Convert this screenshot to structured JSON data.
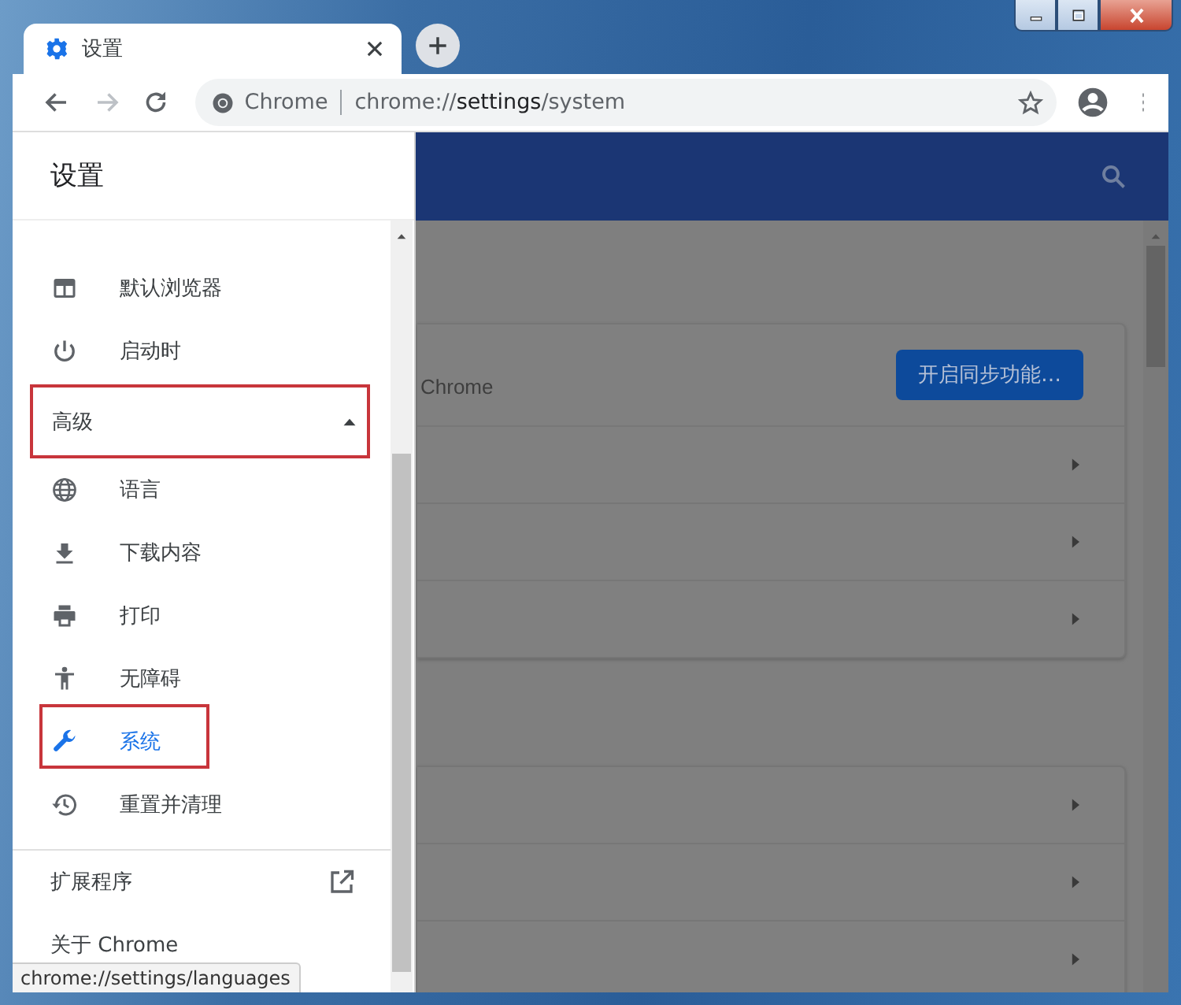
{
  "tabs": [
    {
      "title": "设置",
      "selected": true
    }
  ],
  "toolbar": {
    "site_label": "Chrome",
    "url": {
      "scheme": "chrome://",
      "host": "settings",
      "path": "/system"
    }
  },
  "drawer": {
    "title": "设置",
    "items": [
      {
        "kind": "nav",
        "label": "默认浏览器",
        "selected": false,
        "highlighted": false
      },
      {
        "kind": "nav",
        "label": "启动时",
        "selected": false,
        "highlighted": false
      },
      {
        "kind": "section",
        "label": "高级",
        "expanded": true,
        "highlighted": true
      },
      {
        "kind": "nav",
        "label": "语言",
        "selected": false,
        "highlighted": false
      },
      {
        "kind": "nav",
        "label": "下载内容",
        "selected": false,
        "highlighted": false
      },
      {
        "kind": "nav",
        "label": "打印",
        "selected": false,
        "highlighted": false
      },
      {
        "kind": "nav",
        "label": "无障碍",
        "selected": false,
        "highlighted": false
      },
      {
        "kind": "nav",
        "label": "系统",
        "selected": true,
        "highlighted": true
      },
      {
        "kind": "nav",
        "label": "重置并清理",
        "selected": false,
        "highlighted": false
      },
      {
        "kind": "divider"
      },
      {
        "kind": "link",
        "label": "扩展程序",
        "external": true
      },
      {
        "kind": "link",
        "label": "关于 Chrome",
        "external": false
      }
    ]
  },
  "main": {
    "cards": [
      {
        "rows": [
          {
            "kind": "sync",
            "subtitle": "Chrome",
            "button": "开启同步功能…"
          },
          {
            "kind": "link"
          },
          {
            "kind": "link"
          },
          {
            "kind": "link"
          }
        ]
      },
      {
        "rows": [
          {
            "kind": "link"
          },
          {
            "kind": "link"
          },
          {
            "kind": "link"
          }
        ]
      }
    ]
  },
  "status_tip": "chrome://settings/languages"
}
